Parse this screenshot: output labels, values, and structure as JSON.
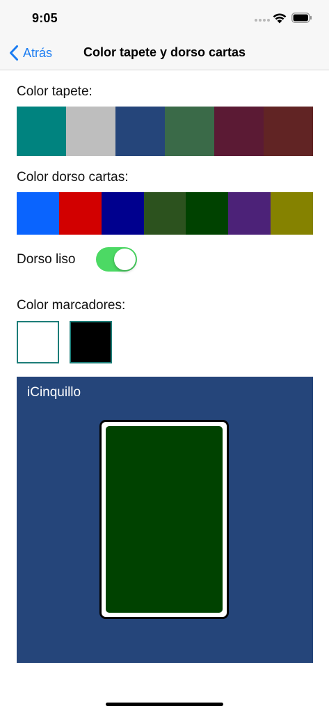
{
  "status_bar": {
    "time": "9:05",
    "icons": [
      "cellular-dots-icon",
      "wifi-icon",
      "battery-icon"
    ]
  },
  "nav": {
    "back_label": "Atrás",
    "title": "Color tapete y dorso cartas",
    "accent_color": "#1a7cf2"
  },
  "tapete": {
    "label": "Color tapete:",
    "colors": [
      "#00837f",
      "#bebebe",
      "#25457a",
      "#3a6a48",
      "#5b1a34",
      "#612424"
    ]
  },
  "dorso": {
    "label": "Color dorso cartas:",
    "colors": [
      "#0a64fe",
      "#d20000",
      "#00008e",
      "#2c521e",
      "#004200",
      "#4c2278",
      "#858200"
    ]
  },
  "toggle": {
    "label": "Dorso liso",
    "on": true,
    "on_color": "#4cd964"
  },
  "marcadores": {
    "label": "Color marcadores:",
    "colors": [
      "#ffffff",
      "#000000"
    ],
    "border_color": "#1c7d78"
  },
  "preview": {
    "title": "iCinquillo",
    "background_color": "#25457a",
    "card_back_color": "#004200"
  }
}
